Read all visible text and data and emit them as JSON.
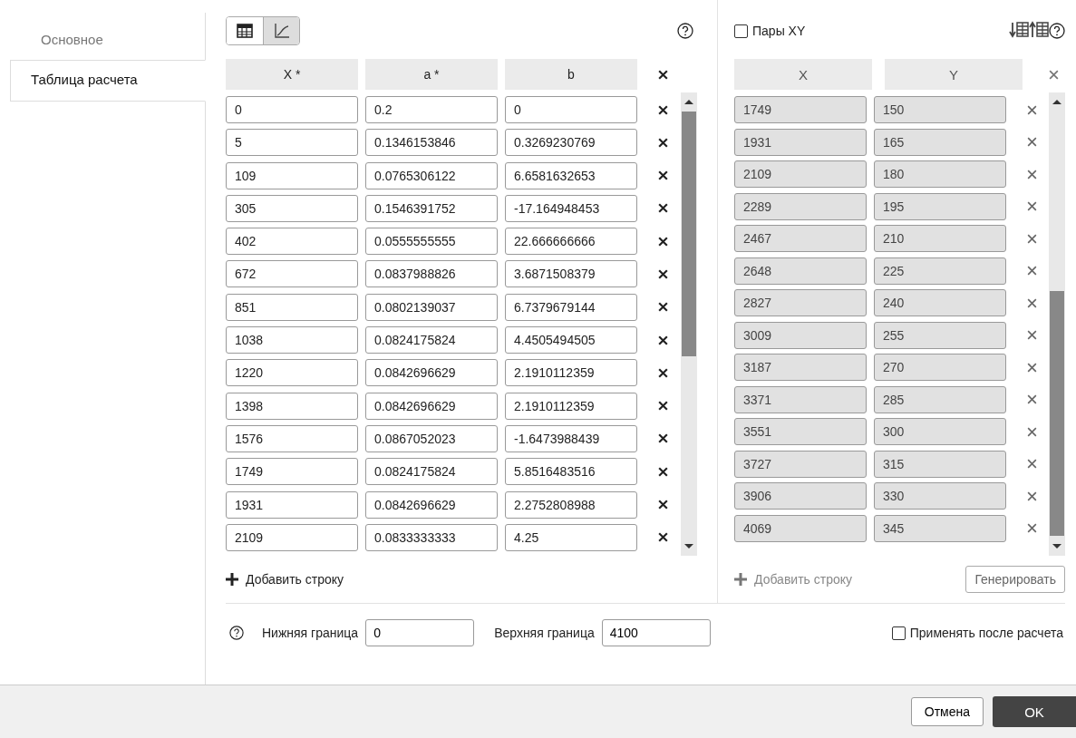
{
  "sidebar": {
    "items": [
      {
        "label": "Основное",
        "selected": false
      },
      {
        "label": "Таблица расчета",
        "selected": true
      }
    ]
  },
  "view_toggle": [
    {
      "kind": "table",
      "selected": false
    },
    {
      "kind": "chart",
      "selected": true
    }
  ],
  "calc_table": {
    "columns": [
      "X *",
      "a *",
      "b"
    ],
    "rows": [
      [
        "0",
        "0.2",
        "0"
      ],
      [
        "5",
        "0.1346153846",
        "0.3269230769"
      ],
      [
        "109",
        "0.0765306122",
        "6.6581632653"
      ],
      [
        "305",
        "0.1546391752",
        "-17.164948453"
      ],
      [
        "402",
        "0.0555555555",
        "22.666666666"
      ],
      [
        "672",
        "0.0837988826",
        "3.6871508379"
      ],
      [
        "851",
        "0.0802139037",
        "6.7379679144"
      ],
      [
        "1038",
        "0.0824175824",
        "4.4505494505"
      ],
      [
        "1220",
        "0.0842696629",
        "2.1910112359"
      ],
      [
        "1398",
        "0.0842696629",
        "2.1910112359"
      ],
      [
        "1576",
        "0.0867052023",
        "-1.6473988439"
      ],
      [
        "1749",
        "0.0824175824",
        "5.8516483516"
      ],
      [
        "1931",
        "0.0842696629",
        "2.2752808988"
      ],
      [
        "2109",
        "0.0833333333",
        "4.25"
      ]
    ],
    "add_row": "Добавить строку",
    "add_disabled": false
  },
  "pairs": {
    "label": "Пары XY",
    "checked": false,
    "columns": [
      "X",
      "Y"
    ],
    "rows": [
      [
        "1749",
        "150"
      ],
      [
        "1931",
        "165"
      ],
      [
        "2109",
        "180"
      ],
      [
        "2289",
        "195"
      ],
      [
        "2467",
        "210"
      ],
      [
        "2648",
        "225"
      ],
      [
        "2827",
        "240"
      ],
      [
        "3009",
        "255"
      ],
      [
        "3187",
        "270"
      ],
      [
        "3371",
        "285"
      ],
      [
        "3551",
        "300"
      ],
      [
        "3727",
        "315"
      ],
      [
        "3906",
        "330"
      ],
      [
        "4069",
        "345"
      ]
    ],
    "disabled": true,
    "add_row": "Добавить строку",
    "add_disabled": true,
    "generate": "Генерировать"
  },
  "bounds": {
    "lower_label": "Нижняя граница",
    "lower": "0",
    "upper_label": "Верхняя граница",
    "upper": "4100",
    "apply": {
      "label": "Применять после расчета",
      "checked": false
    }
  },
  "buttons": {
    "cancel": "Отмена",
    "ok": "OK"
  }
}
